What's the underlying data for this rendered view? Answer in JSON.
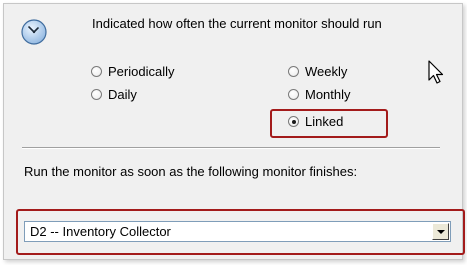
{
  "description": "Indicated how often the current monitor should run",
  "schedule_options": [
    {
      "label": "Periodically",
      "selected": false
    },
    {
      "label": "Daily",
      "selected": false
    },
    {
      "label": "Weekly",
      "selected": false
    },
    {
      "label": "Monthly",
      "selected": false
    },
    {
      "label": "Linked",
      "selected": true
    }
  ],
  "run_after_label": "Run the monitor as soon as the following monitor finishes:",
  "linked_monitor": {
    "value": "D2 -- Inventory Collector"
  },
  "colors": {
    "highlight": "#a31b1b",
    "panel": "#f0f0f0",
    "icon_face": "#a8c8ea"
  },
  "icons": {
    "schedule": "clock-icon",
    "cursor": "arrow-cursor-icon"
  }
}
